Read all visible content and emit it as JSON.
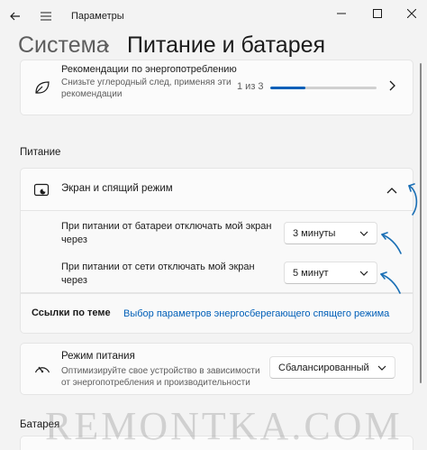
{
  "window": {
    "title": "Параметры",
    "back_icon": "arrow-left-icon",
    "menu_icon": "hamburger-icon"
  },
  "breadcrumb": {
    "parent": "Система",
    "separator": "›",
    "current": "Питание и батарея"
  },
  "recommendations": {
    "title": "Рекомендации по энергопотреблению",
    "description": "Снизьте углеродный след, применяя эти рекомендации",
    "counter": "1 из 3",
    "progress": 0.33,
    "icon": "leaf-icon"
  },
  "power_section": {
    "heading": "Питание",
    "screen_sleep": {
      "label": "Экран и спящий режим",
      "icon": "screen-sleep-icon",
      "expanded": true
    },
    "battery_setting": {
      "label": "При питании от батареи отключать мой экран через",
      "value": "3 минуты"
    },
    "plugged_setting": {
      "label": "При питании от сети отключать мой экран через",
      "value": "5 минут"
    },
    "related": {
      "label": "Ссылки по теме",
      "link": "Выбор параметров энергосберегающего спящего режима"
    },
    "power_mode": {
      "title": "Режим питания",
      "description": "Оптимизируйте свое устройство в зависимости от энергопотребления и производительности",
      "value": "Сбалансированный",
      "icon": "gauge-icon"
    }
  },
  "battery_section": {
    "heading": "Батарея"
  },
  "watermark": "REMONTKA.COM",
  "colors": {
    "accent": "#005fb8",
    "annotation_arrow": "#1a6fb5",
    "background": "#f3f3f3",
    "card": "#fbfbfb"
  }
}
